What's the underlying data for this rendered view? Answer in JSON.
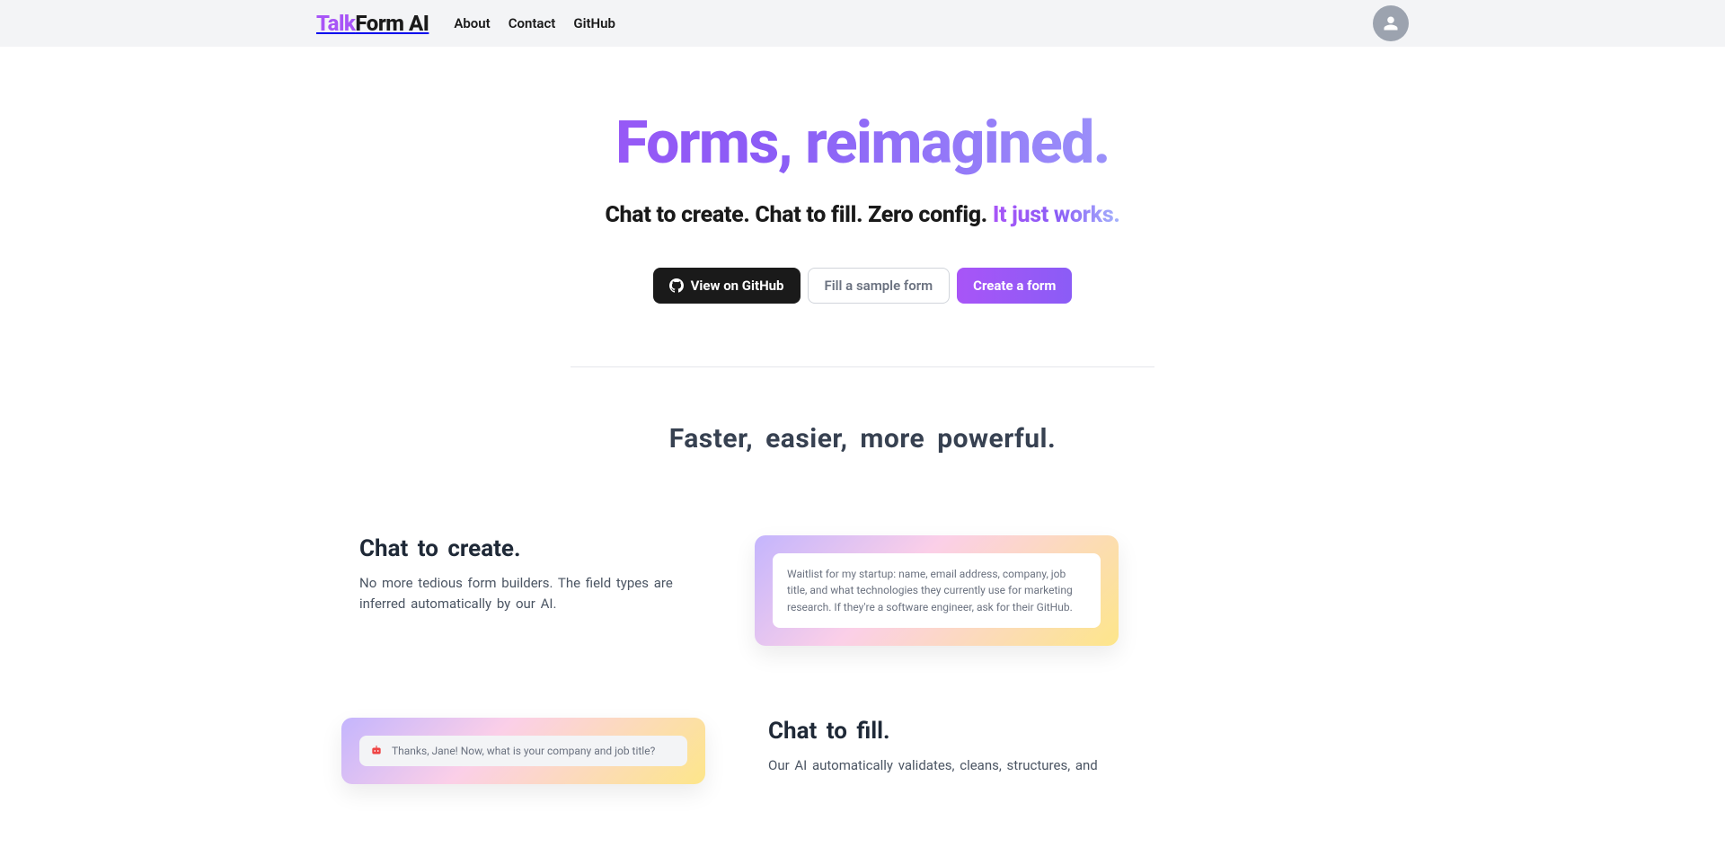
{
  "header": {
    "logo_talk": "Talk",
    "logo_form": "Form AI",
    "nav": {
      "about": "About",
      "contact": "Contact",
      "github": "GitHub"
    }
  },
  "hero": {
    "title": "Forms, reimagined.",
    "sub_plain": "Chat to create. Chat to fill. Zero config. ",
    "sub_grad": "It just works.",
    "cta": {
      "github": "View on GitHub",
      "sample": "Fill a sample form",
      "create": "Create a form"
    }
  },
  "section_title": "Faster, easier, more powerful.",
  "feature1": {
    "heading": "Chat to create.",
    "desc": "No more tedious form builders. The field types are inferred automatically by our AI.",
    "card_text": "Waitlist for my startup: name, email address, company, job title, and what technologies they currently use for marketing research. If they're a software engineer, ask for their GitHub."
  },
  "feature2": {
    "heading": "Chat to fill.",
    "desc": "Our AI automatically validates, cleans, structures, and",
    "card_text": "Thanks, Jane! Now, what is your company and job title?"
  }
}
